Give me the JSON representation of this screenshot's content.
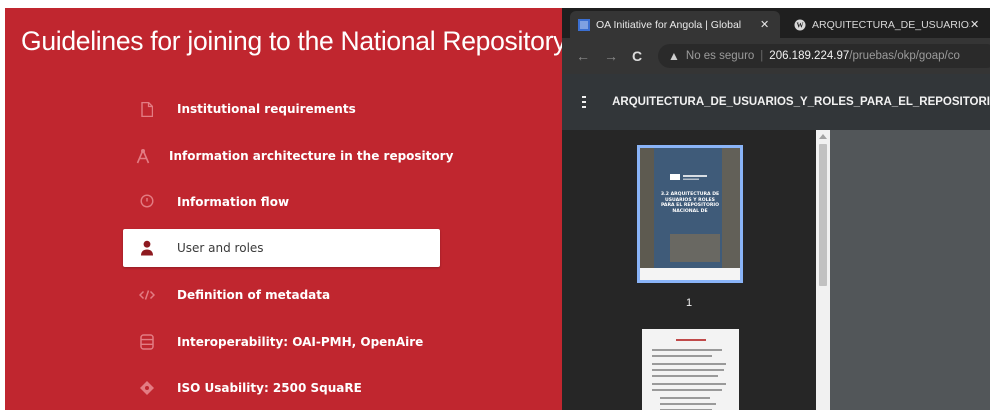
{
  "left_panel": {
    "title": "Guidelines for joining to the National Repository",
    "menu": [
      {
        "label": "Institutional requirements",
        "icon": "document-icon"
      },
      {
        "label": "Information architecture in the repository",
        "icon": "compass-icon"
      },
      {
        "label": "Information flow",
        "icon": "clock-icon"
      },
      {
        "label": "User and roles",
        "icon": "user-icon",
        "active": true
      },
      {
        "label": "Definition of metadata",
        "icon": "code-icon"
      },
      {
        "label": "Interoperability: OAI-PMH, OpenAire",
        "icon": "database-icon"
      },
      {
        "label": "ISO Usability: 2500 SquaRE",
        "icon": "diamond-icon"
      }
    ]
  },
  "browser": {
    "tabs": [
      {
        "label": "OA Initiative for Angola | Global",
        "icon": "site-favicon-icon",
        "close": "✕"
      },
      {
        "label": "ARQUITECTURA_DE_USUARIOS_Y",
        "icon": "wordpress-icon",
        "close": "✕"
      }
    ],
    "address": {
      "security_text": "No es seguro",
      "host": "206.189.224.97",
      "path": "/pruebas/okp/goap/co"
    },
    "pdf": {
      "title": "ARQUITECTURA_DE_USUARIOS_Y_ROLES_PARA_EL_REPOSITORI",
      "page_label": "1",
      "thumbnail_text": "3.2 ARQUITECTURA DE USUARIOS Y ROLES PARA EL REPOSITORIO NACIONAL DE"
    }
  },
  "colors": {
    "brand_red": "#c0262f",
    "icon_pink": "#e37c83",
    "tab_bar": "#1f1f1f",
    "pdf_toolbar": "#323639",
    "thumbnail_highlight": "#8ab4f8"
  }
}
